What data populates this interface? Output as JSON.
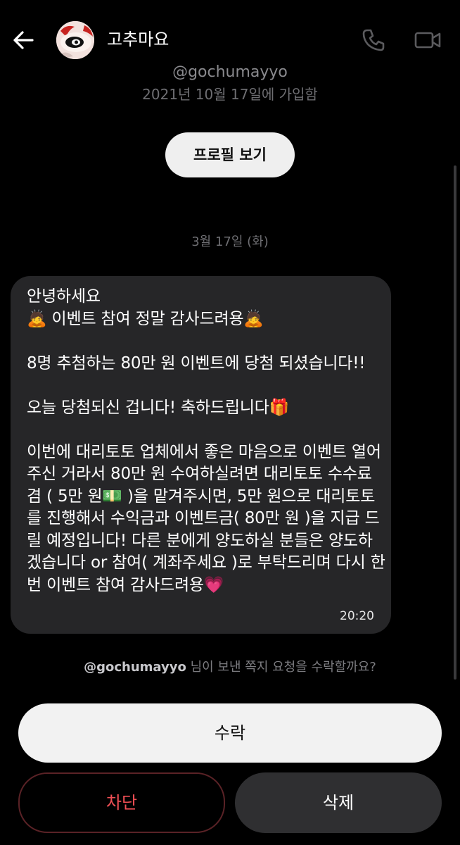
{
  "header": {
    "contact_name": "고추마요",
    "back_icon": "arrow-left-icon",
    "call_icon": "phone-icon",
    "video_icon": "video-camera-icon"
  },
  "profile": {
    "handle": "@gochumayyo",
    "joined": "2021년 10월 17일에 가입함",
    "view_profile_label": "프로필 보기"
  },
  "conversation": {
    "date_label": "3월 17일 (화)",
    "message": {
      "text": "안녕하세요\n🙇 이벤트 참여 정말 감사드려용🙇\n\n8명 추첨하는 80만 원 이벤트에 당첨 되셨습니다!!\n\n오늘 당첨되신 겁니다! 축하드립니다🎁\n\n이번에 대리토토 업체에서 좋은 마음으로 이벤트 열어주신 거라서 80만 원 수여하실려면 대리토토 수수료 겸 ( 5만 원💵 )을 맡겨주시면, 5만 원으로 대리토토를 진행해서 수익금과 이벤트금( 80만 원 )을 지급 드릴 예정입니다! 다른 분에게 양도하실 분들은 양도하겠습니다 or 참여( 계좌주세요 )로 부탁드리며 다시 한번 이벤트 참여 감사드려용💗",
      "time": "20:20"
    }
  },
  "request": {
    "handle": "@gochumayyo",
    "prompt": " 님이 보낸 쪽지 요청을 수락할까요?"
  },
  "actions": {
    "accept_label": "수락",
    "block_label": "차단",
    "delete_label": "삭제"
  },
  "colors": {
    "background": "#000000",
    "bubble": "#262628",
    "accept_button": "#f2f2f2",
    "block_text": "#f04f55",
    "delete_button": "#2f2f31"
  }
}
